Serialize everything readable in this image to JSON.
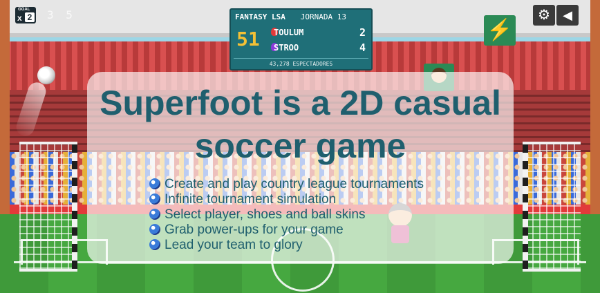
{
  "hud": {
    "goal_label": "GOAL",
    "multiplier_prefix": "x",
    "multiplier_value": "2",
    "match_time": "3 5"
  },
  "scoreboard": {
    "league": "FANTASY LSA",
    "round": "JORNADA 13",
    "clock": "51",
    "home_team": "TOULUM",
    "home_score": "2",
    "away_team": "STROO",
    "away_score": "4",
    "spectators": "43,278 ESPECTADORES"
  },
  "buttons": {
    "powerup_icon": "lightning-icon",
    "powerup_glyph": "⚡",
    "settings_icon": "gear-icon",
    "settings_glyph": "⚙",
    "sound_icon": "speaker-icon",
    "sound_glyph": "◀"
  },
  "promo": {
    "headline": "Superfoot is a 2D casual soccer game",
    "features": [
      "Create and play country league tournaments",
      "Infinite tournament simulation",
      "Select player, shoes and ball skins",
      "Grab power-ups for your game",
      "Lead your team to glory"
    ]
  },
  "colors": {
    "overlay_text": "#1f5f6e",
    "scoreboard_bg": "#1f6f78",
    "clock": "#f4c035",
    "powerup_bg": "#2b8a55"
  }
}
